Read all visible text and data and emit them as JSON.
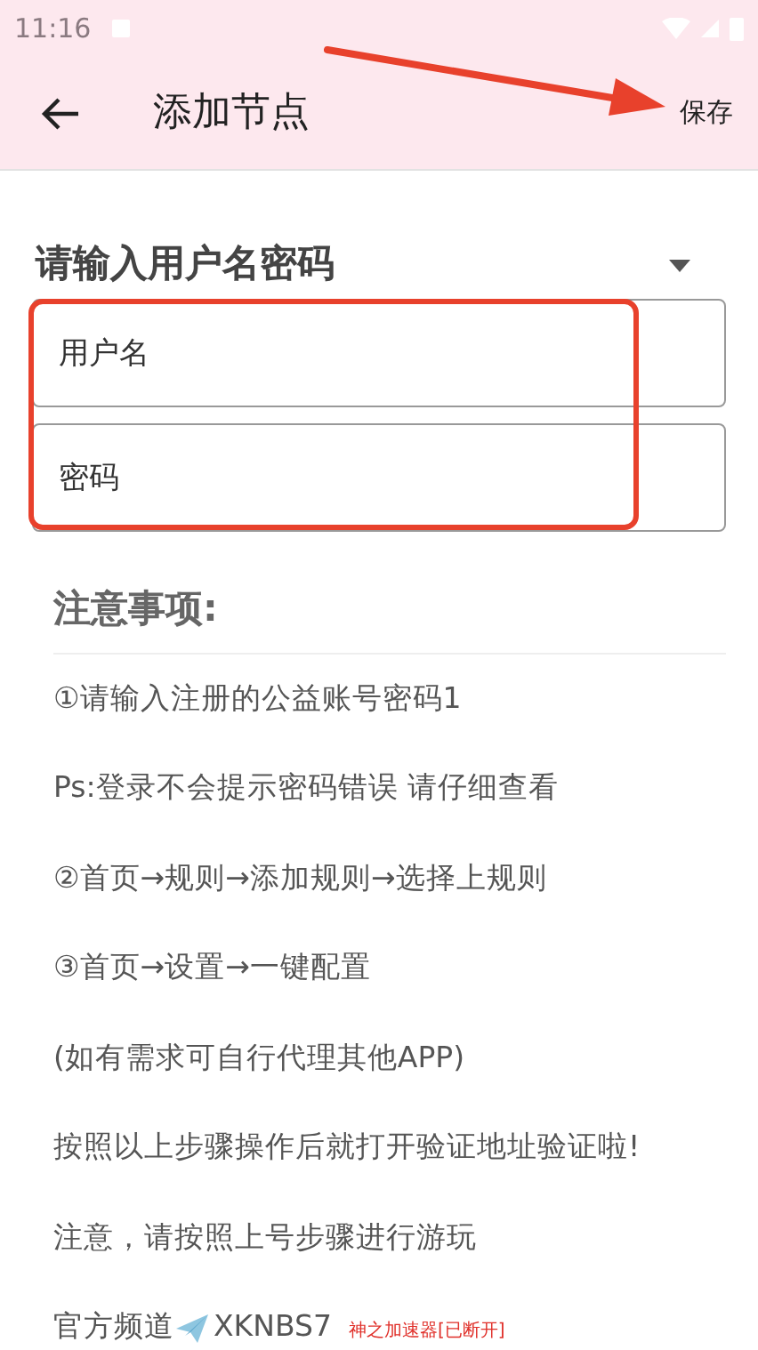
{
  "status_bar": {
    "time": "11:16"
  },
  "toolbar": {
    "title": "添加节点",
    "action": "保存"
  },
  "selector": {
    "value": "请输入用户名密码"
  },
  "fields": [
    {
      "placeholder": "用户名"
    },
    {
      "placeholder": "密码"
    }
  ],
  "notes": {
    "title": "注意事项:",
    "lines": [
      "①请输入注册的公益账号密码1",
      "Ps:登录不会提示密码错误 请仔细查看",
      "②首页→规则→添加规则→选择上规则",
      "③首页→设置→一键配置",
      "(如有需求可自行代理其他APP)",
      "按照以上步骤操作后就打开验证地址验证啦!",
      "注意，请按照上号步骤进行游玩"
    ],
    "channel_label": "官方频道",
    "channel_code": "XKNBS7"
  },
  "overlay_status": "神之加速器[已断开]"
}
